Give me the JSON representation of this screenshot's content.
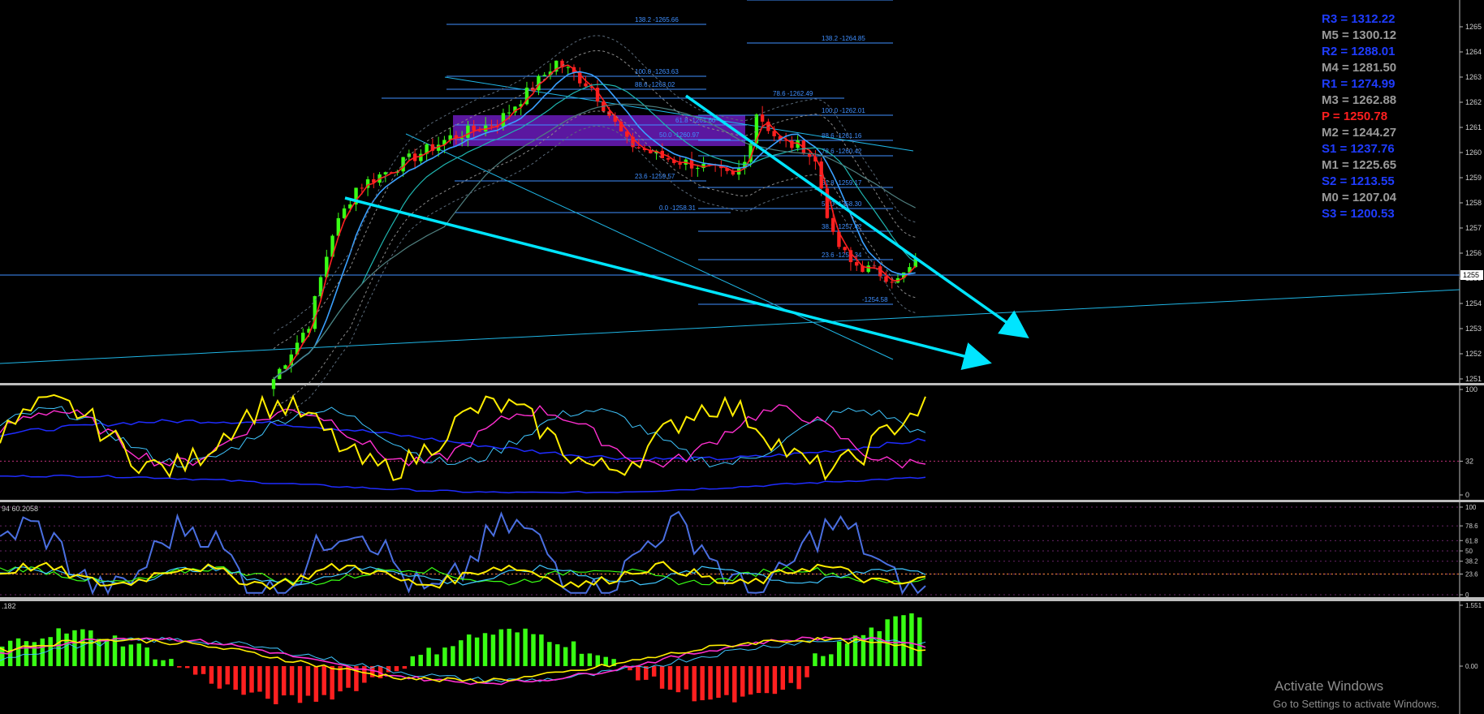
{
  "chart_data": [
    {
      "type": "candlestick",
      "panel": "price",
      "y_axis_ticks": [
        "1265",
        "1264",
        "1263",
        "1262",
        "1261",
        "1260",
        "1259",
        "1258",
        "1257",
        "1256",
        "1255",
        "1254",
        "1253",
        "1252",
        "1251"
      ],
      "current_price_label": "1255",
      "ylim": [
        1251,
        1265
      ],
      "fib_labels": [
        "138.2 -1265.66",
        "138.2 -1264.85",
        "100.0 -1263.63",
        "88.6 -1263.02",
        "78.6 -1262.49",
        "61.8 -1261.60",
        "50.0 -1260.97",
        "23.6 -1259.57",
        "0.0 -1258.31",
        "100.0 -1262.01",
        "88.6 -1261.16",
        "78.6 -1260.42",
        "61.8 -1259.17",
        "50.0 -1258.30",
        "38.2 -1257.42",
        "23.6 -1256.34",
        "-1254.58"
      ],
      "pivots": [
        {
          "label": "R3 = 1312.22",
          "color": "#1f3cff"
        },
        {
          "label": "M5 = 1300.12",
          "color": "#9a9a9a"
        },
        {
          "label": "R2 = 1288.01",
          "color": "#1f3cff"
        },
        {
          "label": "M4 = 1281.50",
          "color": "#9a9a9a"
        },
        {
          "label": "R1 = 1274.99",
          "color": "#1f3cff"
        },
        {
          "label": "M3 = 1262.88",
          "color": "#9a9a9a"
        },
        {
          "label": "P   = 1250.78",
          "color": "#ff1f1f"
        },
        {
          "label": "M2 = 1244.27",
          "color": "#9a9a9a"
        },
        {
          "label": "S1 = 1237.76",
          "color": "#1f3cff"
        },
        {
          "label": "M1 = 1225.65",
          "color": "#9a9a9a"
        },
        {
          "label": "S2 = 1213.55",
          "color": "#1f3cff"
        },
        {
          "label": "M0 = 1207.04",
          "color": "#9a9a9a"
        },
        {
          "label": "S3 = 1200.53",
          "color": "#1f3cff"
        }
      ]
    },
    {
      "type": "line",
      "panel": "oscillator-1",
      "y_axis_ticks": [
        "100",
        "32",
        "0"
      ]
    },
    {
      "type": "line",
      "panel": "oscillator-2",
      "header": "94 60.2058",
      "y_axis_ticks": [
        "100",
        "78.6",
        "61.8",
        "50",
        "38.2",
        "23.6",
        "0"
      ]
    },
    {
      "type": "bar",
      "panel": "histogram",
      "header": ".182",
      "y_axis_ticks": [
        "1.551",
        "0.00"
      ]
    }
  ],
  "watermark": {
    "title": "Activate Windows",
    "subtitle": "Go to Settings to activate Windows."
  },
  "colors": {
    "background": "#000000",
    "bull": "#39ff14",
    "bear": "#ff2020",
    "trendline": "#00e5ff",
    "fib": "#3f8fff",
    "zone": "#7a1fd6"
  }
}
